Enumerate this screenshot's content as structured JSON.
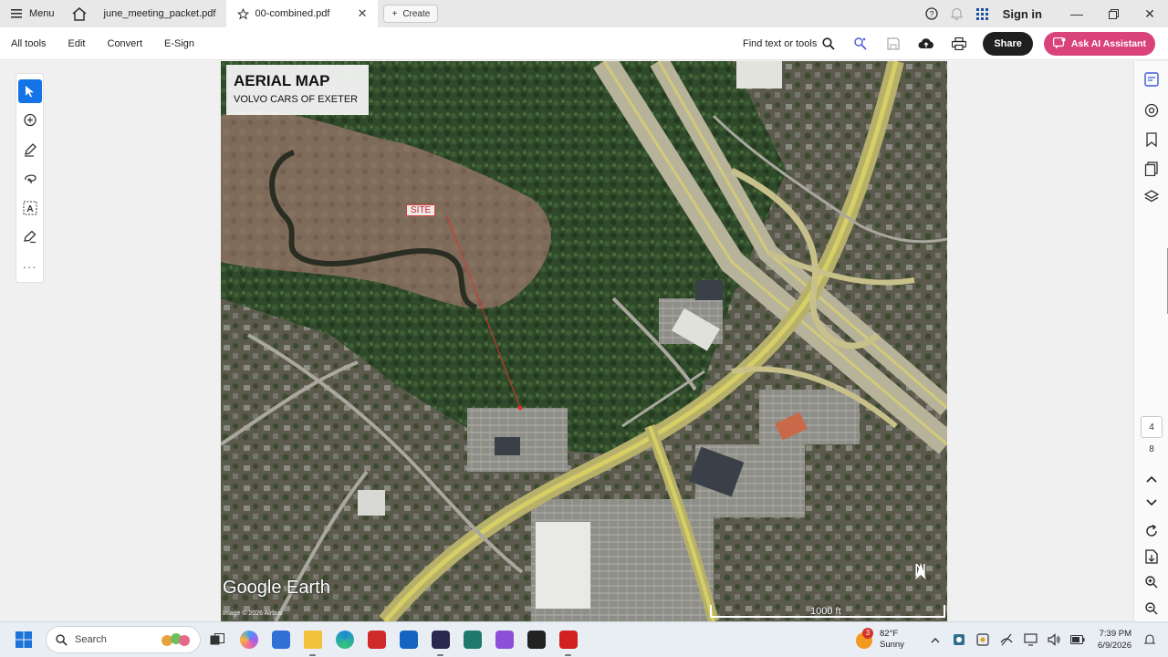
{
  "titlebar": {
    "menu_label": "Menu",
    "tabs": [
      {
        "label": "june_meeting_packet.pdf"
      },
      {
        "label": "00-combined.pdf"
      }
    ],
    "create_label": "Create",
    "signin_label": "Sign in"
  },
  "toolbar": {
    "items": [
      "All tools",
      "Edit",
      "Convert",
      "E-Sign"
    ],
    "find_label": "Find text or tools",
    "share_label": "Share",
    "ai_label": "Ask AI Assistant"
  },
  "map": {
    "title": "AERIAL MAP",
    "subtitle": "VOLVO CARS OF EXETER",
    "site_label": "SITE",
    "logo": "Google Earth",
    "credit": "Image © 2026 Airbus",
    "north": "N",
    "scale": "1000 ft"
  },
  "rightrail": {
    "current_page": "4",
    "total_pages": "8"
  },
  "taskbar": {
    "search_placeholder": "Search",
    "weather_badge": "3",
    "temperature": "82°F",
    "condition": "Sunny",
    "time": "7:39 PM",
    "date": "6/9/2026"
  },
  "colors": {
    "accent": "#1473e6",
    "share": "#1f1f1f",
    "ai": "#d9437a",
    "site_marker": "#e03030"
  }
}
